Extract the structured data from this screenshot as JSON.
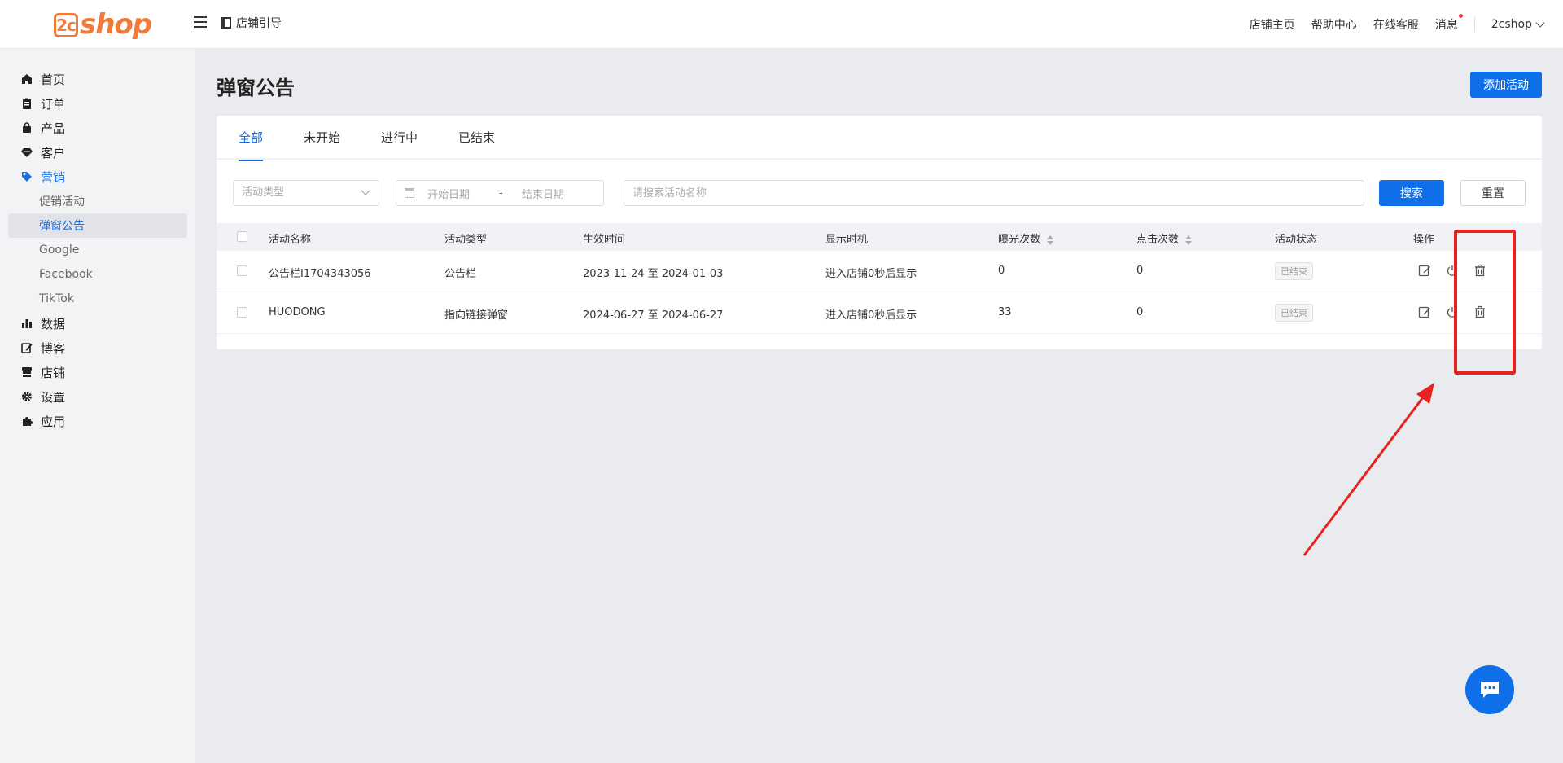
{
  "brand": {
    "logo_badge": "2c",
    "logo_text": "shop"
  },
  "header": {
    "guide_label": "店铺引导",
    "nav": [
      "店铺主页",
      "帮助中心",
      "在线客服",
      "消息"
    ],
    "user": "2cshop"
  },
  "sidebar": {
    "items": [
      {
        "label": "首页",
        "icon": "home-icon"
      },
      {
        "label": "订单",
        "icon": "clipboard-icon"
      },
      {
        "label": "产品",
        "icon": "bag-icon"
      },
      {
        "label": "客户",
        "icon": "diamond-icon"
      },
      {
        "label": "营销",
        "icon": "tag-icon"
      },
      {
        "label": "数据",
        "icon": "bar-chart-icon"
      },
      {
        "label": "博客",
        "icon": "edit-doc-icon"
      },
      {
        "label": "店铺",
        "icon": "store-icon"
      },
      {
        "label": "设置",
        "icon": "gear-icon"
      },
      {
        "label": "应用",
        "icon": "puzzle-icon"
      }
    ],
    "marketing_sub": [
      "促销活动",
      "弹窗公告",
      "Google",
      "Facebook",
      "TikTok"
    ]
  },
  "page": {
    "title": "弹窗公告",
    "add_button": "添加活动"
  },
  "tabs": [
    "全部",
    "未开始",
    "进行中",
    "已结束"
  ],
  "filters": {
    "type_placeholder": "活动类型",
    "start_placeholder": "开始日期",
    "dash": "-",
    "end_placeholder": "结束日期",
    "search_placeholder": "请搜索活动名称",
    "search_button": "搜索",
    "reset_button": "重置"
  },
  "table": {
    "headers": [
      "活动名称",
      "活动类型",
      "生效时间",
      "显示时机",
      "曝光次数",
      "点击次数",
      "活动状态",
      "操作"
    ],
    "rows": [
      {
        "name": "公告栏I1704343056",
        "type": "公告栏",
        "time": "2023-11-24 至 2024-01-03",
        "timing": "进入店铺0秒后显示",
        "views": "0",
        "clicks": "0",
        "status": "已结束"
      },
      {
        "name": "HUODONG",
        "type": "指向链接弹窗",
        "time": "2024-06-27 至 2024-06-27",
        "timing": "进入店铺0秒后显示",
        "views": "33",
        "clicks": "0",
        "status": "已结束"
      }
    ]
  },
  "colors": {
    "accent": "#0f6fe8",
    "brand": "#f07c3c",
    "annotation": "#e8221e"
  }
}
